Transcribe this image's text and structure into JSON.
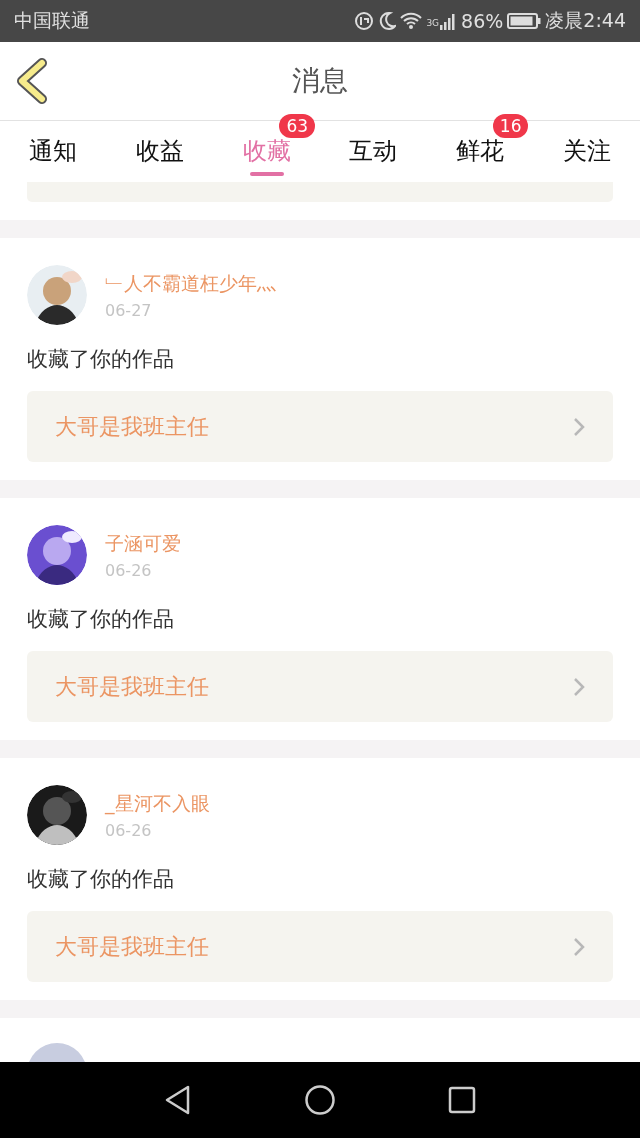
{
  "status_bar": {
    "carrier": "中国联通",
    "network": "3G",
    "battery": "86%",
    "time": "凌晨2:44"
  },
  "header": {
    "title": "消息"
  },
  "tabs": [
    {
      "label": "通知",
      "selected": false
    },
    {
      "label": "收益",
      "selected": false
    },
    {
      "label": "收藏",
      "selected": true,
      "badge": "63"
    },
    {
      "label": "互动",
      "selected": false
    },
    {
      "label": "鲜花",
      "selected": false,
      "badge": "16"
    },
    {
      "label": "关注",
      "selected": false
    }
  ],
  "messages": [
    {
      "user": "﹂人不霸道枉少年灬",
      "date": "06-27",
      "action": "收藏了你的作品",
      "work": "大哥是我班主任"
    },
    {
      "user": "子涵可爱",
      "date": "06-26",
      "action": "收藏了你的作品",
      "work": "大哥是我班主任"
    },
    {
      "user": "_星河不入眼",
      "date": "06-26",
      "action": "收藏了你的作品",
      "work": "大哥是我班主任"
    }
  ]
}
